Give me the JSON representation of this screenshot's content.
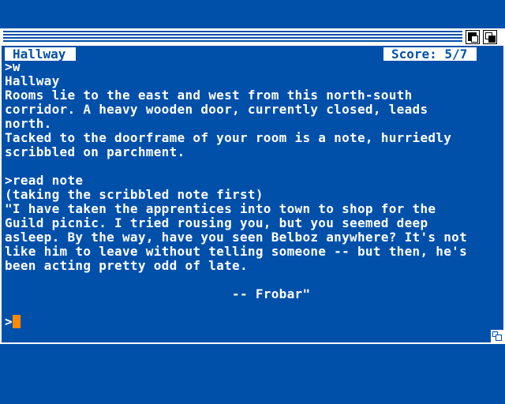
{
  "status": {
    "room": "Hallway",
    "score": "Score: 5/7"
  },
  "transcript": [
    ">w",
    "Hallway",
    "Rooms lie to the east and west from this north-south",
    "corridor. A heavy wooden door, currently closed, leads",
    "north.",
    "Tacked to the doorframe of your room is a note, hurriedly",
    "scribbled on parchment.",
    "",
    ">read note",
    "(taking the scribbled note first)",
    "\"I have taken the apprentices into town to shop for the",
    "Guild picnic. I tried rousing you, but you seemed deep",
    "asleep. By the way, have you seen Belboz anywhere? It's not",
    "like him to leave without telling someone -- but then, he's",
    "been acting pretty odd of late.",
    "",
    "                             -- Frobar\""
  ],
  "prompt": ">",
  "colors": {
    "background": "#0050aa",
    "text": "#ffffff",
    "cursor": "#ff8a00"
  }
}
